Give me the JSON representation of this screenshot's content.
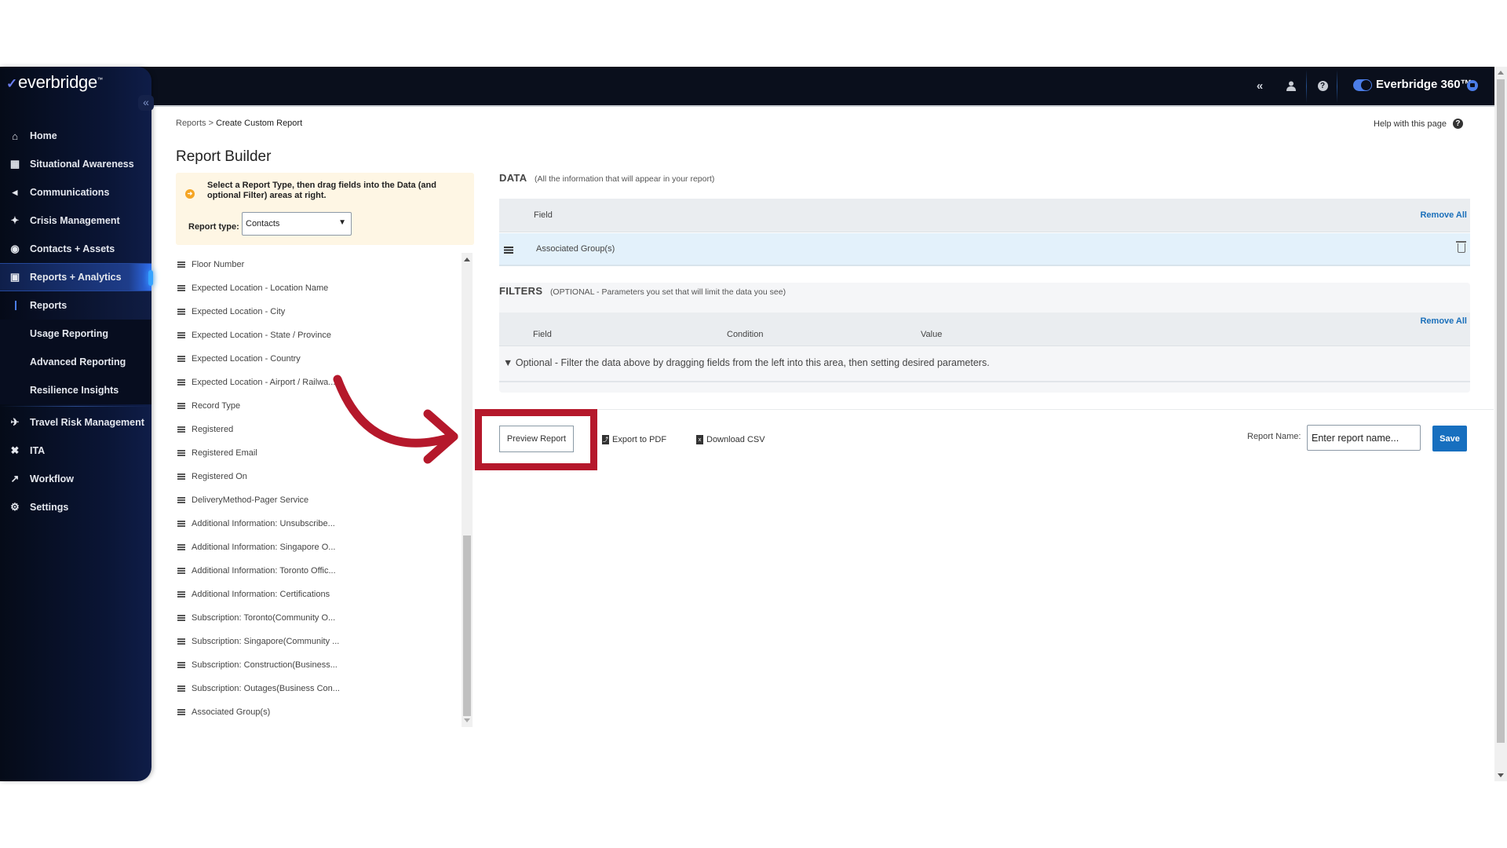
{
  "topbar": {
    "collapse_all_icon": "double-chevron-left",
    "user_icon": "user",
    "help_icon": "question-circle",
    "toggle_on": true,
    "product_name": "Everbridge 360™",
    "chat_icon": "chat-bubble"
  },
  "sidebar": {
    "logo": "everbridge",
    "collapse_icon": "«",
    "items": [
      {
        "label": "Home",
        "icon": "⌂"
      },
      {
        "label": "Situational Awareness",
        "icon": "▦"
      },
      {
        "label": "Communications",
        "icon": "◂"
      },
      {
        "label": "Crisis Management",
        "icon": "✦"
      },
      {
        "label": "Contacts + Assets",
        "icon": "◉"
      },
      {
        "label": "Reports + Analytics",
        "icon": "▣",
        "active": true
      }
    ],
    "sub_items": [
      {
        "label": "Reports",
        "current": true
      },
      {
        "label": "Usage Reporting"
      },
      {
        "label": "Advanced Reporting"
      },
      {
        "label": "Resilience Insights"
      }
    ],
    "items_after": [
      {
        "label": "Travel Risk Management",
        "icon": "✈"
      },
      {
        "label": "ITA",
        "icon": "✖"
      },
      {
        "label": "Workflow",
        "icon": "↗"
      },
      {
        "label": "Settings",
        "icon": "⚙"
      }
    ]
  },
  "breadcrumb": {
    "parent": "Reports",
    "separator": ">",
    "current": "Create Custom Report"
  },
  "help_link": "Help with this page",
  "page_title": "Report Builder",
  "notice": {
    "text": "Select a Report Type, then drag fields into the Data (and optional Filter) areas at right.",
    "report_type_label": "Report type:",
    "report_type_value": "Contacts"
  },
  "fields": [
    "Floor Number",
    "Expected Location - Location Name",
    "Expected Location - City",
    "Expected Location - State / Province",
    "Expected Location - Country",
    "Expected Location - Airport / Railwa...",
    "Record Type",
    "Registered",
    "Registered Email",
    "Registered On",
    "DeliveryMethod-Pager Service",
    "Additional Information: Unsubscribe...",
    "Additional Information: Singapore O...",
    "Additional Information: Toronto Offic...",
    "Additional Information: Certifications",
    "Subscription: Toronto(Community O...",
    "Subscription: Singapore(Community ...",
    "Subscription: Construction(Business...",
    "Subscription: Outages(Business Con...",
    "Associated Group(s)"
  ],
  "data_section": {
    "title": "DATA",
    "subtitle": "(All the information that will appear in your report)",
    "column_field": "Field",
    "remove_all": "Remove All",
    "rows": [
      "Associated Group(s)"
    ]
  },
  "filters_section": {
    "title": "FILTERS",
    "subtitle": "(OPTIONAL - Parameters you set that will limit the data you see)",
    "columns": [
      "Field",
      "Condition",
      "Value"
    ],
    "remove_all": "Remove All",
    "empty_text": "Optional - Filter the data above by dragging fields from the left into this area, then setting desired parameters."
  },
  "actions": {
    "preview": "Preview Report",
    "export_pdf": "Export to PDF",
    "download_csv": "Download CSV",
    "report_name_label": "Report Name:",
    "report_name_placeholder": "Enter report name...",
    "report_name_value": "",
    "save": "Save"
  },
  "annotation": {
    "color": "#b5182b",
    "target": "Preview Report"
  }
}
